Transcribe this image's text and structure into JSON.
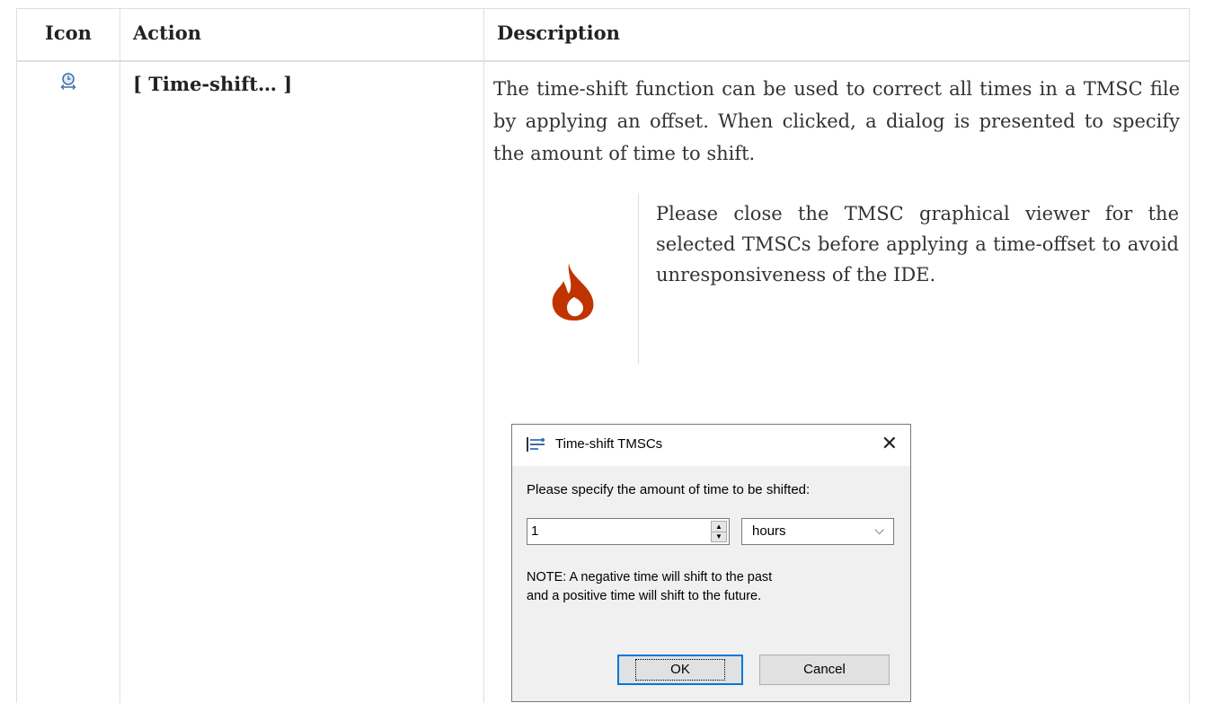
{
  "table": {
    "headers": {
      "icon": "Icon",
      "action": "Action",
      "description": "Description"
    },
    "row": {
      "icon_name": "time-shift-icon",
      "action": "[ Time-shift… ]",
      "description": "The time-shift function can be used to correct all times in a TMSC file by applying an offset. When clicked, a dialog is presented to specify the amount of time to shift."
    }
  },
  "admonition": {
    "type": "caution",
    "icon_name": "fire-icon",
    "icon_color": "#bf3400",
    "text": "Please close the TMSC graphical viewer for the selected TMSCs before applying a time-offset to avoid unresponsiveness of the IDE."
  },
  "dialog": {
    "title": "Time-shift TMSCs",
    "close_symbol": "✕",
    "prompt": "Please specify the amount of time to be shifted:",
    "amount_value": "1",
    "unit_value": "hours",
    "note_line1": "NOTE: A negative time will shift to the past",
    "note_line2": "and a positive time will shift to the future.",
    "ok_label": "OK",
    "cancel_label": "Cancel",
    "accent_color": "#0078d7"
  }
}
